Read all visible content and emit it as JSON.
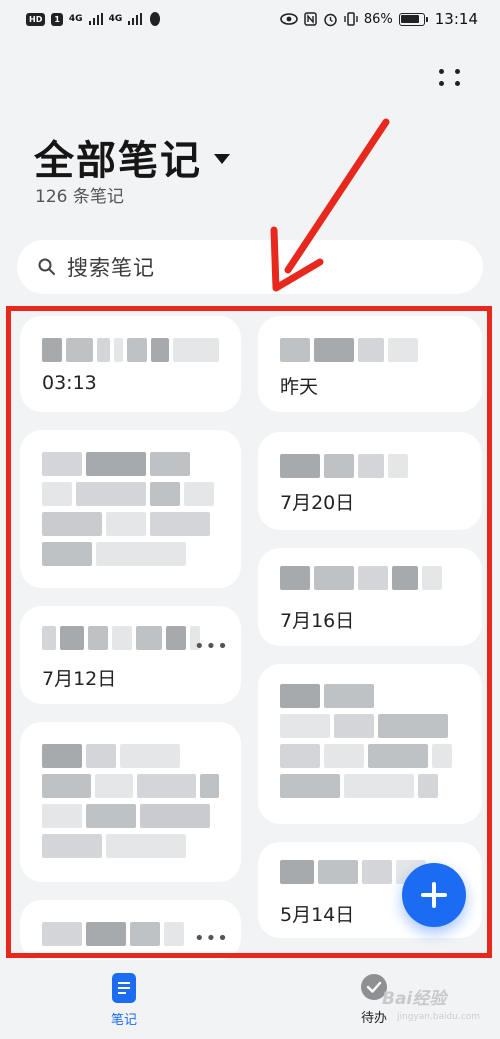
{
  "status_bar": {
    "left_chips": [
      "HD",
      "1"
    ],
    "network_1": "4G",
    "network_2": "4G",
    "battery": "86%",
    "battery_level": 0.86,
    "time": "13:14"
  },
  "header": {
    "title": "全部笔记",
    "count": "126 条笔记"
  },
  "search": {
    "placeholder": "搜索笔记"
  },
  "notes_left": [
    {
      "date": "03:13"
    },
    {
      "date": ""
    },
    {
      "date": "7月12日"
    },
    {
      "date": ""
    },
    {
      "date": ""
    }
  ],
  "notes_right": [
    {
      "date": "昨天"
    },
    {
      "date": "7月20日"
    },
    {
      "date": "7月16日"
    },
    {
      "date": ""
    },
    {
      "date": "5月14日"
    }
  ],
  "bottom_nav": {
    "notes_label": "笔记",
    "todo_label": "待办"
  },
  "watermark": {
    "text": "Bai经验",
    "sub": "jingyan.baidu.com"
  },
  "colors": {
    "accent": "#1b6cf2",
    "highlight": "#e8281c",
    "background": "#f1f3f5"
  }
}
